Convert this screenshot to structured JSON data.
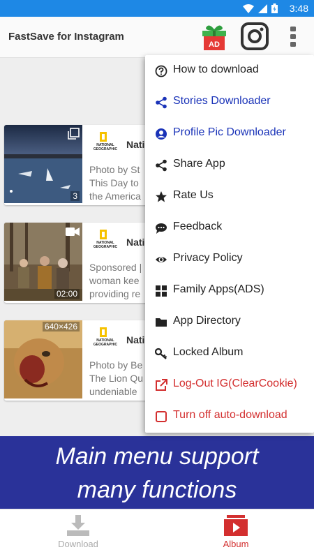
{
  "status": {
    "time": "3:48"
  },
  "app": {
    "title": "FastSave for Instagram",
    "gift_label": "AD"
  },
  "feed": [
    {
      "name": "Nati",
      "logo_text": "NATIONAL GEOGRAPHIC",
      "desc": "Photo by St\nThis Day to\nthe America",
      "badge": "3"
    },
    {
      "name": "Nati",
      "logo_text": "NATIONAL GEOGRAPHIC",
      "desc": "Sponsored |\nwoman kee\nproviding re",
      "badge": "02:00"
    },
    {
      "name": "Nati",
      "logo_text": "NATIONAL GEOGRAPHIC",
      "desc": "Photo by Be\nThe Lion Qu\nundeniable",
      "badge": "640×426"
    }
  ],
  "menu": {
    "items": [
      {
        "label": "How to download",
        "icon": "help-circle-icon"
      },
      {
        "label": "Stories Downloader",
        "icon": "share-nodes-icon"
      },
      {
        "label": "Profile Pic Downloader",
        "icon": "account-circle-icon"
      },
      {
        "label": "Share App",
        "icon": "share-icon"
      },
      {
        "label": "Rate Us",
        "icon": "star-icon"
      },
      {
        "label": "Feedback",
        "icon": "chat-bubble-icon"
      },
      {
        "label": "Privacy Policy",
        "icon": "eye-icon"
      },
      {
        "label": "Family Apps(ADS)",
        "icon": "grid-icon"
      },
      {
        "label": "App Directory",
        "icon": "folder-icon"
      },
      {
        "label": "Locked Album",
        "icon": "key-icon"
      },
      {
        "label": "Log-Out IG(ClearCookie)",
        "icon": "external-link-icon"
      },
      {
        "label": "Turn off auto-download",
        "icon": "checkbox-icon"
      }
    ]
  },
  "banner": {
    "line1": "Main menu support",
    "line2": "many functions"
  },
  "bottom_nav": {
    "download": "Download",
    "album": "Album"
  },
  "colors": {
    "status_bar": "#1e88e5",
    "banner": "#2a3299",
    "accent_red": "#d32f2f",
    "menu_blue": "#1a33b8"
  }
}
